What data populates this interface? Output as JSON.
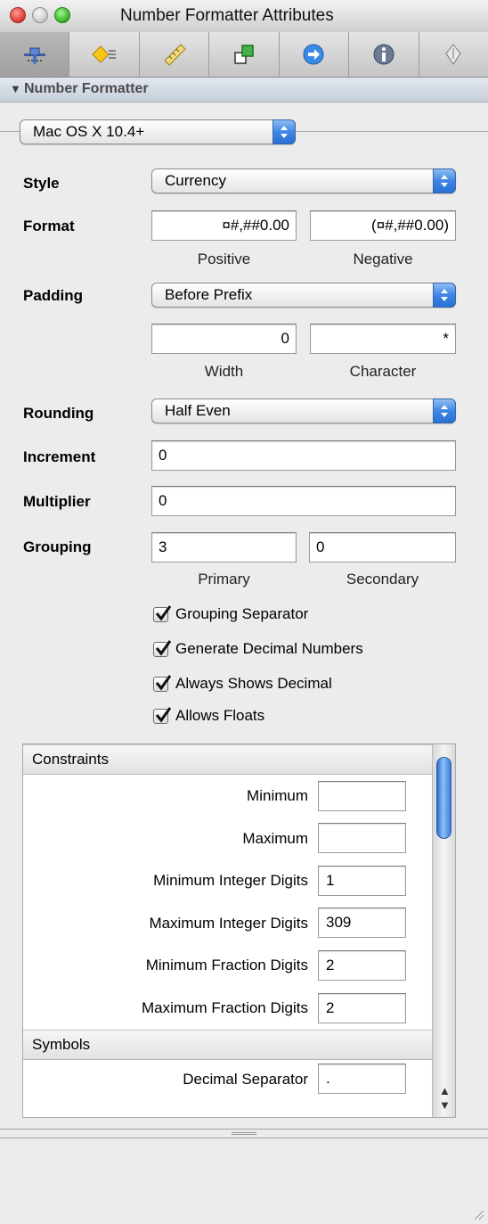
{
  "window": {
    "title": "Number Formatter Attributes"
  },
  "toolbar": {
    "tabs": [
      {
        "icon": "bindings-pin-icon",
        "selected": true
      },
      {
        "icon": "diamond-connections-icon",
        "selected": false
      },
      {
        "icon": "ruler-size-icon",
        "selected": false
      },
      {
        "icon": "identity-shapes-icon",
        "selected": false
      },
      {
        "icon": "arrow-circle-icon",
        "selected": false
      },
      {
        "icon": "info-icon",
        "selected": false
      },
      {
        "icon": "pen-nib-icon",
        "selected": false
      }
    ]
  },
  "section": {
    "title": "Number Formatter"
  },
  "behavior": {
    "value": "Mac OS X 10.4+"
  },
  "form": {
    "style": {
      "label": "Style",
      "value": "Currency"
    },
    "format": {
      "label": "Format",
      "positive": "¤#,##0.00",
      "negative": "(¤#,##0.00)",
      "positive_label": "Positive",
      "negative_label": "Negative"
    },
    "padding": {
      "label": "Padding",
      "value": "Before Prefix",
      "width": "0",
      "character": "*",
      "width_label": "Width",
      "character_label": "Character"
    },
    "rounding": {
      "label": "Rounding",
      "value": "Half Even"
    },
    "increment": {
      "label": "Increment",
      "value": "0"
    },
    "multiplier": {
      "label": "Multiplier",
      "value": "0"
    },
    "grouping": {
      "label": "Grouping",
      "primary": "3",
      "secondary": "0",
      "primary_label": "Primary",
      "secondary_label": "Secondary"
    },
    "checkboxes": [
      {
        "label": "Grouping Separator",
        "checked": true
      },
      {
        "label": "Generate Decimal Numbers",
        "checked": true
      },
      {
        "label": "Always Shows Decimal",
        "checked": true
      },
      {
        "label": "Allows Floats",
        "checked": true
      }
    ]
  },
  "constraints": {
    "header": "Constraints",
    "rows": [
      {
        "label": "Minimum",
        "value": ""
      },
      {
        "label": "Maximum",
        "value": ""
      },
      {
        "label": "Minimum Integer Digits",
        "value": "1"
      },
      {
        "label": "Maximum Integer Digits",
        "value": "309"
      },
      {
        "label": "Minimum Fraction Digits",
        "value": "2"
      },
      {
        "label": "Maximum Fraction Digits",
        "value": "2"
      }
    ]
  },
  "symbols": {
    "header": "Symbols",
    "rows": [
      {
        "label": "Decimal Separator",
        "value": "."
      }
    ]
  },
  "colors": {
    "accent": "#3f86e6",
    "section_header": "#c7cfda"
  }
}
